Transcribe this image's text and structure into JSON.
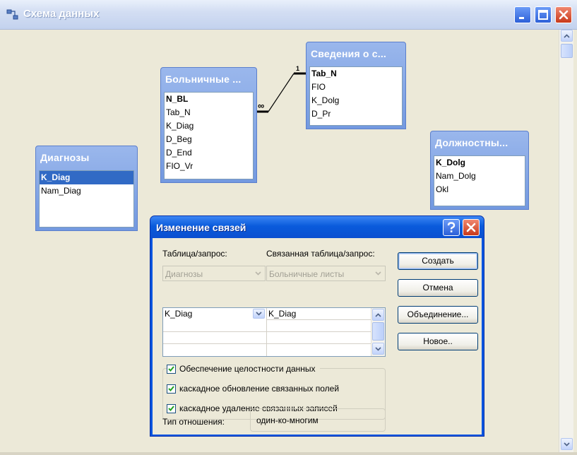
{
  "window": {
    "title": "Схема данных",
    "icon": "relationships-icon"
  },
  "tables": [
    {
      "id": "bolnichnye",
      "title": "Больничные ...",
      "fields": [
        "N_BL",
        "Tab_N",
        "K_Diag",
        "D_Beg",
        "D_End",
        "FIO_Vr"
      ],
      "primary_key": "N_BL"
    },
    {
      "id": "svedeniya",
      "title": "Сведения о с...",
      "fields": [
        "Tab_N",
        "FIO",
        "K_Dolg",
        "D_Pr"
      ],
      "primary_key": "Tab_N"
    },
    {
      "id": "diagnozy",
      "title": "Диагнозы",
      "fields": [
        "K_Diag",
        "Nam_Diag"
      ],
      "primary_key": "K_Diag",
      "selected": "K_Diag"
    },
    {
      "id": "dolzhnostnye",
      "title": "Должностны...",
      "fields": [
        "K_Dolg",
        "Nam_Dolg",
        "Okl"
      ],
      "primary_key": "K_Dolg"
    }
  ],
  "relationship": {
    "one_label": "1",
    "many_label": "∞"
  },
  "dialog": {
    "title": "Изменение связей",
    "table_label": "Таблица/запрос:",
    "related_label": "Связанная таблица/запрос:",
    "table_value": "Диагнозы",
    "related_value": "Больничные листы",
    "field_rows": [
      {
        "left": "K_Diag",
        "right": "K_Diag"
      },
      {
        "left": "",
        "right": ""
      },
      {
        "left": "",
        "right": ""
      },
      {
        "left": "",
        "right": ""
      }
    ],
    "checkboxes": [
      {
        "label": "Обеспечение целостности данных",
        "checked": true
      },
      {
        "label": "каскадное обновление связанных полей",
        "checked": true
      },
      {
        "label": "каскадное удаление связанных записей",
        "checked": true
      }
    ],
    "rel_type_label": "Тип отношения:",
    "rel_type_value": "один-ко-многим",
    "buttons": {
      "create": "Создать",
      "cancel": "Отмена",
      "join": "Объединение...",
      "new": "Новое.."
    }
  },
  "colors": {
    "table_header": "#7399e0",
    "dialog_title": "#0a55e0",
    "selection": "#316ac5",
    "close_button": "#c8391a"
  }
}
